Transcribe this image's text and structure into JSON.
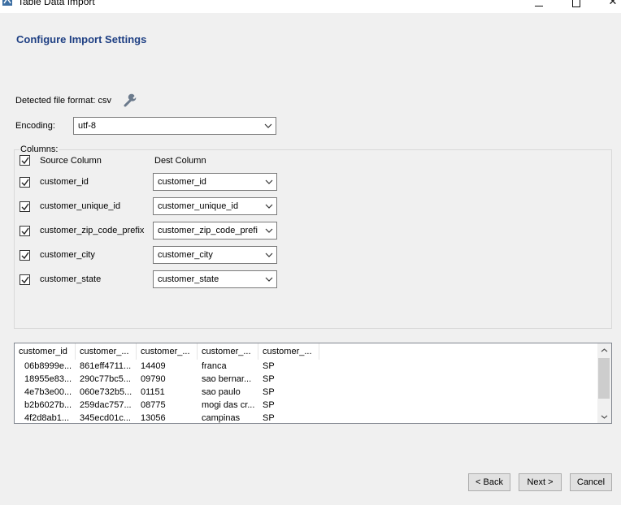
{
  "window": {
    "title": "Table Data Import",
    "minimize_icon": "minimize-icon",
    "maximize_icon": "maximize-icon",
    "close_icon": "close-icon",
    "close_glyph": "✕"
  },
  "page": {
    "heading": "Configure Import Settings",
    "format_label": "Detected file format: csv",
    "format_icon": "wrench-icon",
    "encoding_label": "Encoding:",
    "encoding_value": "utf-8"
  },
  "columns": {
    "legend": "Columns:",
    "source_header": "Source Column",
    "dest_header": "Dest Column",
    "header_checked": true,
    "rows": [
      {
        "source": "customer_id",
        "dest": "customer_id",
        "checked": true
      },
      {
        "source": "customer_unique_id",
        "dest": "customer_unique_id",
        "checked": true
      },
      {
        "source": "customer_zip_code_prefix",
        "dest": "customer_zip_code_prefi",
        "checked": true
      },
      {
        "source": "customer_city",
        "dest": "customer_city",
        "checked": true
      },
      {
        "source": "customer_state",
        "dest": "customer_state",
        "checked": true
      }
    ]
  },
  "preview": {
    "headers": [
      "customer_id",
      "customer_...",
      "customer_...",
      "customer_...",
      "customer_..."
    ],
    "rows": [
      [
        "06b8999e...",
        "861eff4711...",
        "14409",
        "franca",
        "SP"
      ],
      [
        "18955e83...",
        "290c77bc5...",
        "09790",
        "sao bernar...",
        "SP"
      ],
      [
        "4e7b3e00...",
        "060e732b5...",
        "01151",
        "sao paulo",
        "SP"
      ],
      [
        "b2b6027b...",
        "259dac757...",
        "08775",
        "mogi das cr...",
        "SP"
      ],
      [
        "4f2d8ab1...",
        "345ecd01c...",
        "13056",
        "campinas",
        "SP"
      ]
    ]
  },
  "buttons": {
    "back": "< Back",
    "next": "Next >",
    "cancel": "Cancel"
  },
  "colors": {
    "heading": "#1e3f83",
    "background": "#f0f0f0"
  }
}
